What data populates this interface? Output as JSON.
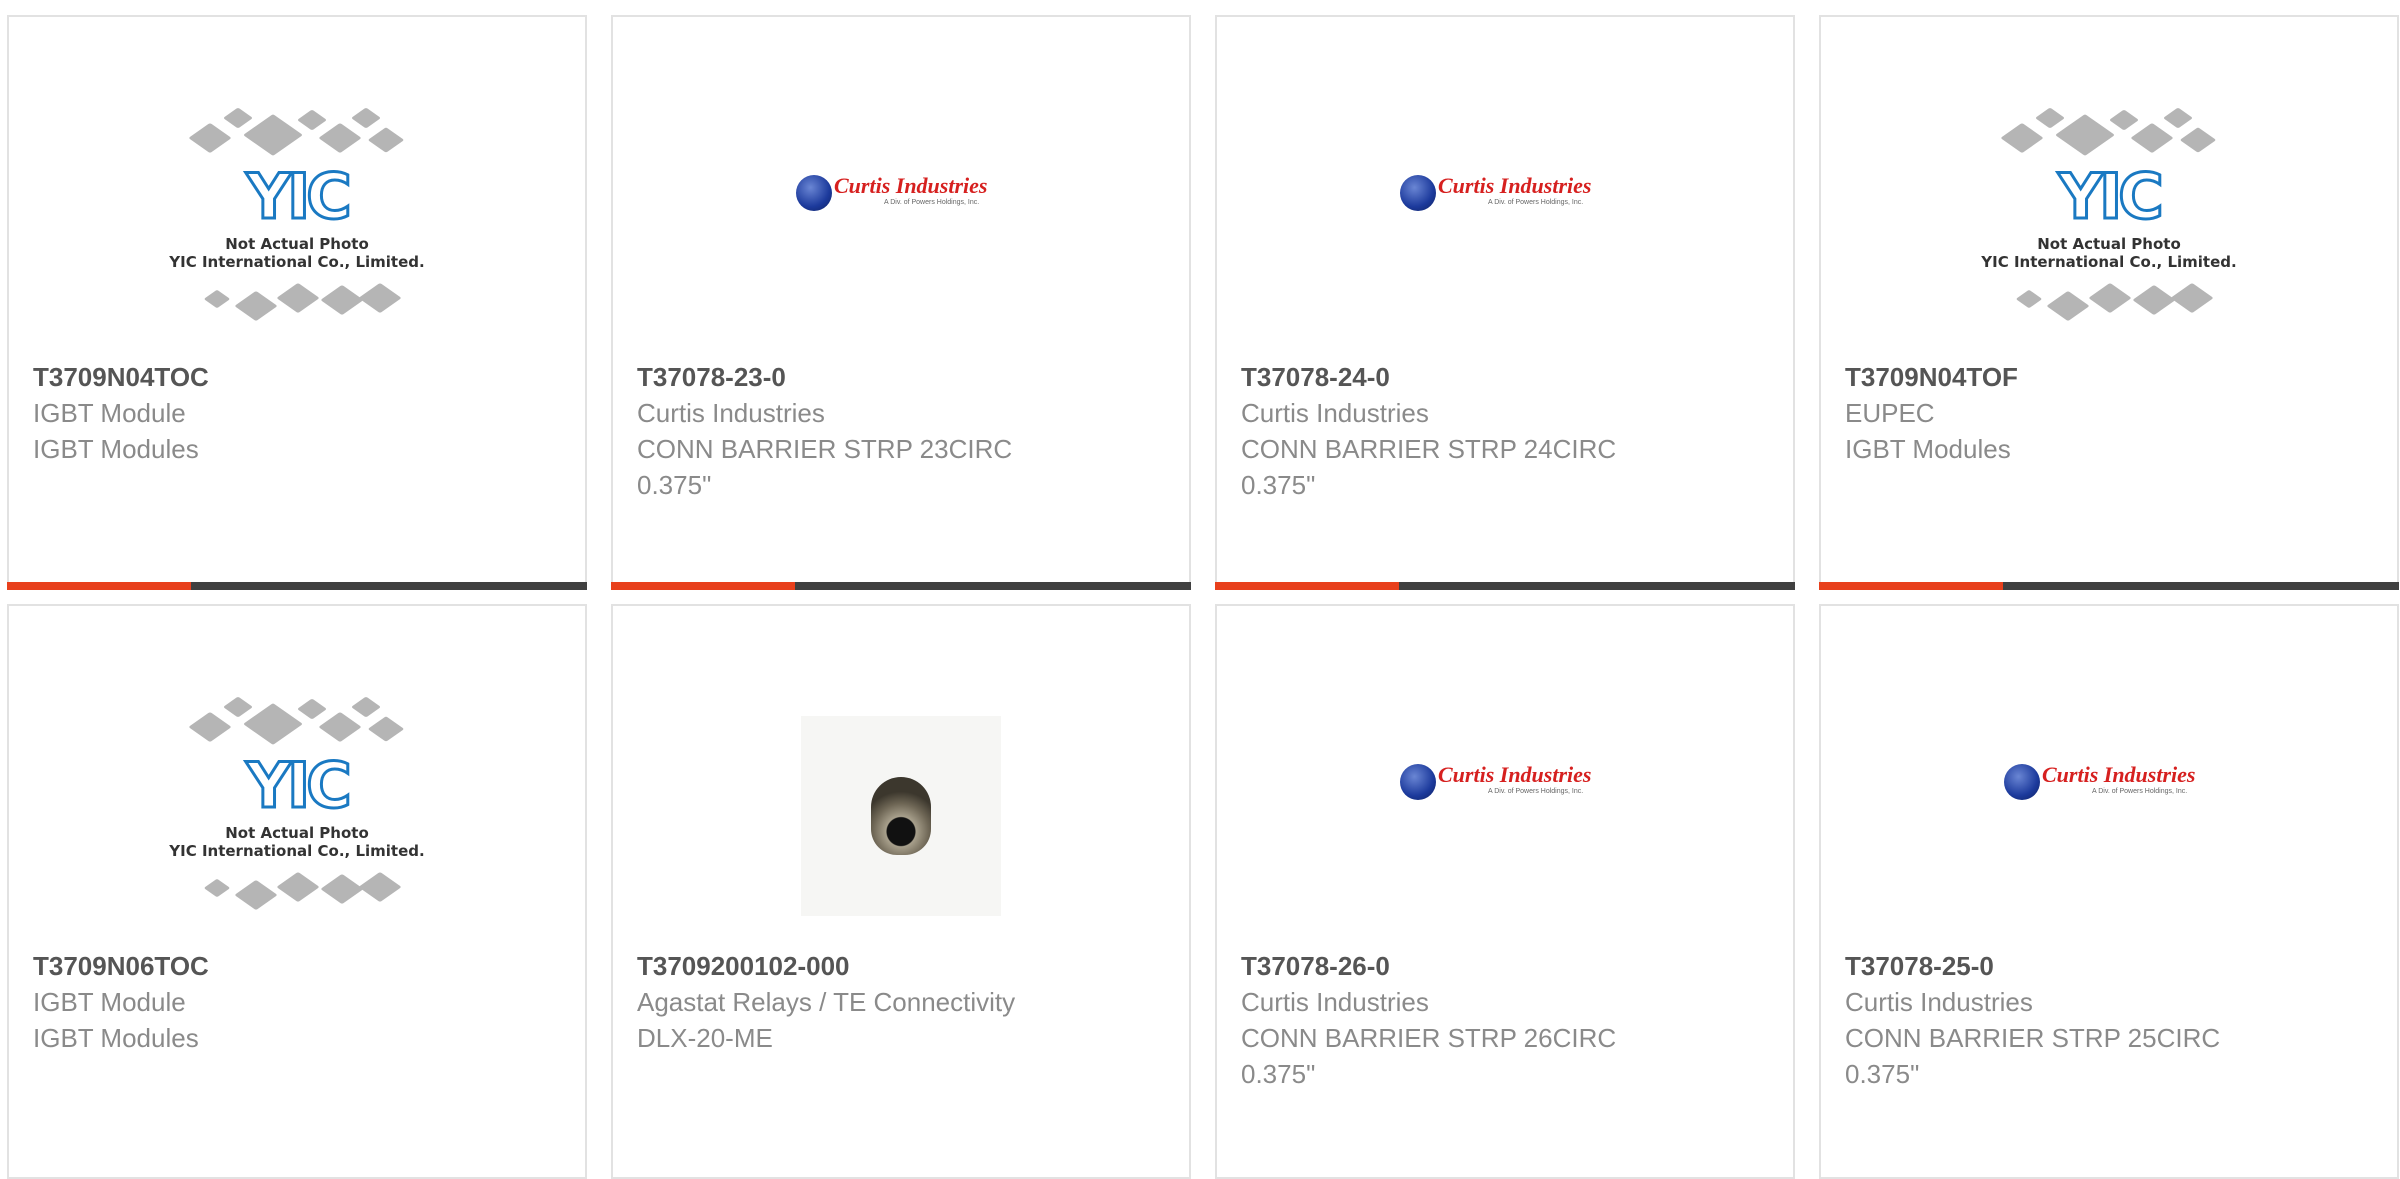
{
  "cards": [
    {
      "part": "T3709N04TOC",
      "lines": [
        "IGBT Module",
        "IGBT Modules"
      ],
      "image": "yic-placeholder"
    },
    {
      "part": "T37078-23-0",
      "lines": [
        "Curtis Industries",
        "CONN BARRIER STRP 23CIRC 0.375\""
      ],
      "image": "curtis-logo"
    },
    {
      "part": "T37078-24-0",
      "lines": [
        "Curtis Industries",
        "CONN BARRIER STRP 24CIRC 0.375\""
      ],
      "image": "curtis-logo"
    },
    {
      "part": "T3709N04TOF",
      "lines": [
        "EUPEC",
        "IGBT Modules"
      ],
      "image": "yic-placeholder"
    },
    {
      "part": "T3709N06TOC",
      "lines": [
        "IGBT Module",
        "IGBT Modules"
      ],
      "image": "yic-placeholder"
    },
    {
      "part": "T3709200102-000",
      "lines": [
        "Agastat Relays / TE Connectivity",
        "DLX-20-ME"
      ],
      "image": "connector-photo"
    },
    {
      "part": "T37078-26-0",
      "lines": [
        "Curtis Industries",
        "CONN BARRIER STRP 26CIRC 0.375\""
      ],
      "image": "curtis-logo"
    },
    {
      "part": "T37078-25-0",
      "lines": [
        "Curtis Industries",
        "CONN BARRIER STRP 25CIRC 0.375\""
      ],
      "image": "curtis-logo"
    }
  ],
  "logos": {
    "curtis_brand": "Curtis Industries",
    "curtis_tag": "A Div. of Powers Holdings, Inc.",
    "yic_mark": "YIC",
    "yic_caption1": "Not Actual Photo",
    "yic_caption2": "YIC International Co., Limited."
  },
  "colors": {
    "accent": "#e8401c",
    "bar": "#404040",
    "border": "#e2e2e2",
    "part_text": "#555555",
    "detail_text": "#8a8a8a"
  }
}
